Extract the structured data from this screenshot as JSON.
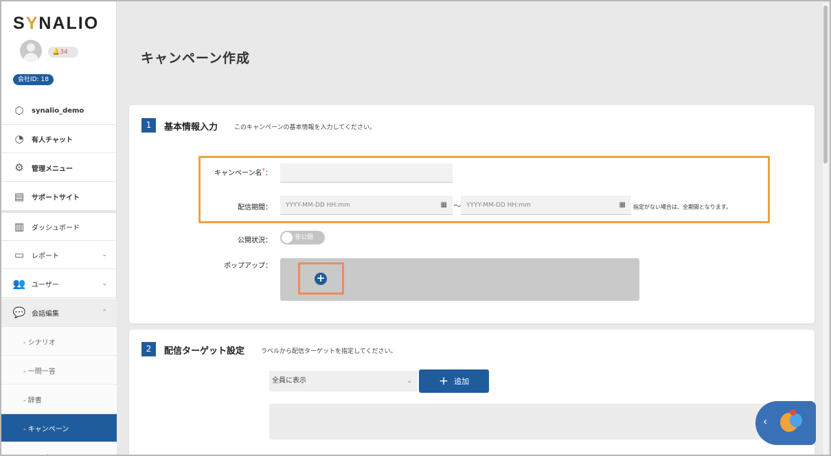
{
  "app": {
    "logo": "SYNALIO"
  },
  "user": {
    "notifications": "34",
    "company_id": "会社ID: 18"
  },
  "sidebar": {
    "items": [
      {
        "label": "synalio_demo",
        "icon": "cube-icon"
      },
      {
        "label": "有人チャット",
        "icon": "headset-icon"
      },
      {
        "label": "管理メニュー",
        "icon": "gears-icon"
      },
      {
        "label": "サポートサイト",
        "icon": "window-icon"
      },
      {
        "label": "ダッシュボード",
        "icon": "bar-chart-icon"
      },
      {
        "label": "レポート",
        "icon": "report-icon"
      },
      {
        "label": "ユーザー",
        "icon": "users-icon"
      },
      {
        "label": "会話編集",
        "icon": "chat-icon"
      }
    ],
    "sub_items": [
      {
        "label": "- シナリオ"
      },
      {
        "label": "- 一問一答"
      },
      {
        "label": "- 辞書"
      },
      {
        "label": "- キャンペーン",
        "active": true
      },
      {
        "label": "- テンプレート"
      }
    ]
  },
  "page": {
    "title": "キャンペーン作成"
  },
  "section1": {
    "number": "1",
    "title": "基本情報入力",
    "description": "このキャンペーンの基本情報を入力してください。",
    "campaign_name_label": "キャンペーン名",
    "campaign_name_required": "*",
    "campaign_name_colon": "：",
    "campaign_name_value": "",
    "period_label": "配信期間：",
    "period_start_placeholder": "YYYY-MM-DD HH:mm",
    "period_end_placeholder": "YYYY-MM-DD HH:mm",
    "period_separator": "～",
    "period_note": "指定がない場合は、全期間となります。",
    "status_label": "公開状況：",
    "status_toggle": "非公開",
    "popup_label": "ポップアップ：",
    "popup_add": "+"
  },
  "section2": {
    "number": "2",
    "title": "配信ターゲット設定",
    "description": "ラベルから配信ターゲットを指定してください。",
    "target_select": "全員に表示",
    "add_button": "追加",
    "add_button_plus": "+"
  },
  "colors": {
    "primary": "#1f5c9c",
    "highlight_orange": "#f0a23c",
    "highlight_red": "#ef8a5c"
  }
}
